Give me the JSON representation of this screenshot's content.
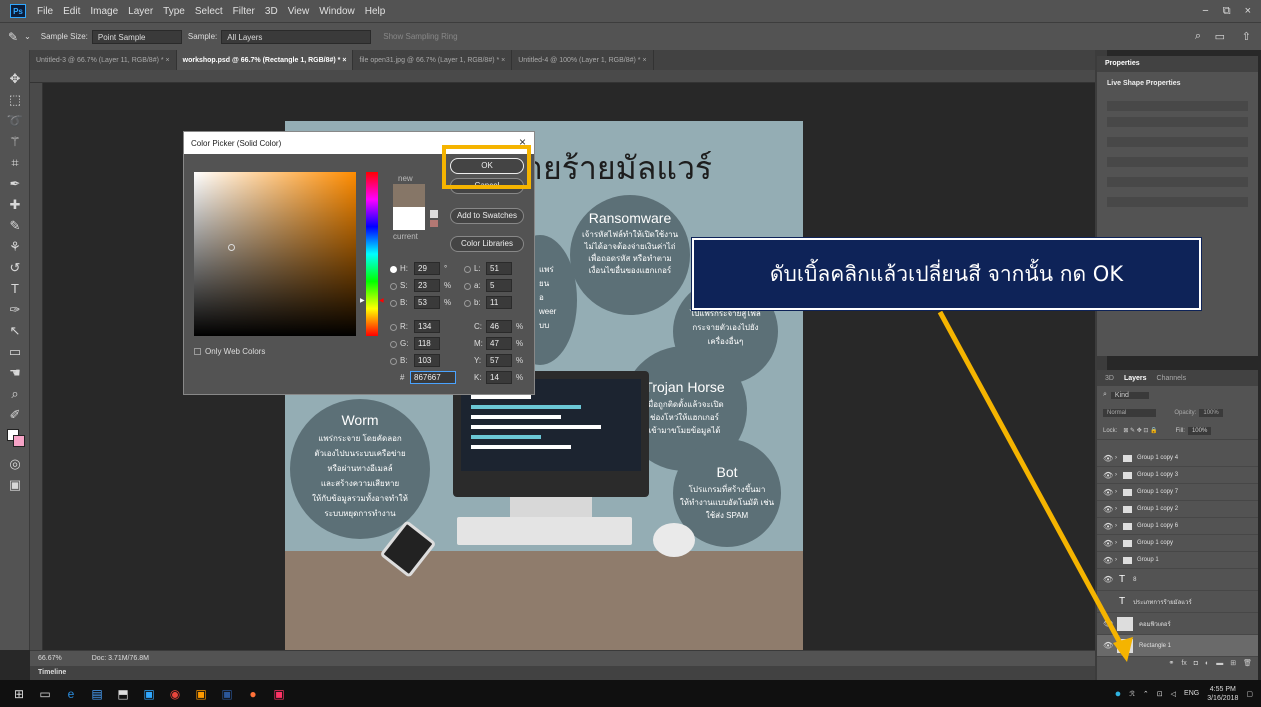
{
  "app": {
    "logo": "Ps",
    "menu": [
      "File",
      "Edit",
      "Image",
      "Layer",
      "Type",
      "Select",
      "Filter",
      "3D",
      "View",
      "Window",
      "Help"
    ],
    "window_controls": [
      "−",
      "⧉",
      "×"
    ]
  },
  "options_bar": {
    "sample_size_label": "Sample Size:",
    "sample_size_value": "Point Sample",
    "sample_label": "Sample:",
    "sample_value": "All Layers",
    "show_ring": "Show Sampling Ring"
  },
  "tabs": [
    {
      "label": "Untitled-3 @ 66.7% (Layer 11, RGB/8#) *  ×",
      "active": false
    },
    {
      "label": "workshop.psd @ 66.7% (Rectangle 1, RGB/8#) *  ×",
      "active": true
    },
    {
      "label": "file open31.jpg @ 66.7% (Layer 1, RGB/8#) *  ×",
      "active": false
    },
    {
      "label": "Untitled-4 @ 100% (Layer 1, RGB/8#) *  ×",
      "active": false
    }
  ],
  "document": {
    "title": "ายร้ายมัลแวร์",
    "bubbles": [
      {
        "title": "Ransomware",
        "text": "เจ้ารหัสไฟล์ทำให้เปิดใช้งาน\nไม่ได้อาจต้องจ่ายเงินค่าไถ่\nเพื่อถอดรหัส หรือทำตาม\nเงื่อนไขอื่นของแฮกเกอร์"
      },
      {
        "title": "",
        "text": "แพร่\nยน\nอ\nweer\nบบ"
      },
      {
        "title": "",
        "text": "ไปแพร่กระจายสู่ไฟล์\nกระจายตัวเองไปยัง\nเครื่องอื่นๆ"
      },
      {
        "title": "Trojan Horse",
        "text": "เมื่อถูกติดตั้งแล้วจะเปิด\nช่องโหว่ให้แฮกเกอร์\nเข้ามาขโมยข้อมูลได้"
      },
      {
        "title": "Worm",
        "text": "แพร่กระจาย โดยคัดลอก\nตัวเองไปบนระบบเครือข่าย\nหรือผ่านทางอีเมลล์\nและสร้างความเสียหาย\nให้กับข้อมูลรวมทั้งอาจทำให้\nระบบหยุดการทำงาน"
      },
      {
        "title": "Bot",
        "text": "โปรแกรมที่สร้างขึ้นมา\nให้ทำงานแบบอัตโนมัติ เช่น\nใช้ส่ง SPAM"
      }
    ]
  },
  "dialog": {
    "title": "Color Picker (Solid Color)",
    "close": "×",
    "ok_label": "OK",
    "cancel_label": "Cancel",
    "add_swatches_label": "Add to Swatches",
    "color_libraries_label": "Color Libraries",
    "new_label": "new",
    "current_label": "current",
    "only_web_colors": "Only Web Colors",
    "new_color": "#867667",
    "current_color": "#ffffff",
    "fields": {
      "H": {
        "value": "29",
        "unit": "°"
      },
      "S": {
        "value": "23",
        "unit": "%"
      },
      "B": {
        "value": "53",
        "unit": "%"
      },
      "R": {
        "value": "134",
        "unit": ""
      },
      "G": {
        "value": "118",
        "unit": ""
      },
      "B2": {
        "value": "103",
        "unit": ""
      },
      "L": {
        "value": "51",
        "unit": ""
      },
      "a": {
        "value": "5",
        "unit": ""
      },
      "b": {
        "value": "11",
        "unit": ""
      },
      "C": {
        "value": "46",
        "unit": "%"
      },
      "M": {
        "value": "47",
        "unit": "%"
      },
      "Y": {
        "value": "57",
        "unit": "%"
      },
      "K": {
        "value": "14",
        "unit": "%"
      }
    },
    "hex_label": "#",
    "hex_value": "867667"
  },
  "callout": {
    "text": "ดับเบิ้ลคลิกแล้วเปลี่ยนสี จากนั้น กด OK"
  },
  "status": {
    "zoom": "66.67%",
    "doc": "Doc: 3.71M/76.8M",
    "timeline": "Timeline"
  },
  "properties": {
    "title": "Properties",
    "subtitle": "Live Shape Properties"
  },
  "layers": {
    "tabs": [
      "3D",
      "Layers",
      "Channels"
    ],
    "kind": "Kind",
    "blend": "Normal",
    "opacity_label": "Opacity:",
    "opacity": "100%",
    "lock_label": "Lock:",
    "fill_label": "Fill:",
    "fill": "100%",
    "items": [
      {
        "name": "Group 1 copy 4",
        "type": "group"
      },
      {
        "name": "Group 1 copy 3",
        "type": "group"
      },
      {
        "name": "Group 1 copy 7",
        "type": "group"
      },
      {
        "name": "Group 1 copy 2",
        "type": "group"
      },
      {
        "name": "Group 1 copy 6",
        "type": "group"
      },
      {
        "name": "Group 1 copy",
        "type": "group"
      },
      {
        "name": "Group 1",
        "type": "group"
      },
      {
        "name": "8",
        "type": "text"
      },
      {
        "name": "ประเภทการร้ายมัลแวร์",
        "type": "text"
      },
      {
        "name": "คอมพิวเตอร์",
        "type": "image"
      },
      {
        "name": "Rectangle 1",
        "type": "shape"
      }
    ]
  },
  "taskbar": {
    "language": "ENG",
    "time": "4:55 PM",
    "date": "3/16/2018"
  },
  "colors": {
    "accent": "#f5b400",
    "callout_bg": "#0e2358",
    "doc_bg": "#94adb4",
    "bubble": "#5c7077"
  }
}
